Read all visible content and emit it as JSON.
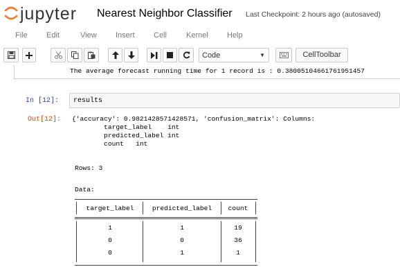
{
  "header": {
    "logo_text": "jupyter",
    "notebook_name": "Nearest Neighbor Classifier",
    "checkpoint": "Last Checkpoint: 2 hours ago (autosaved)"
  },
  "menubar": {
    "items": [
      "File",
      "Edit",
      "View",
      "Insert",
      "Cell",
      "Kernel",
      "Help"
    ]
  },
  "toolbar": {
    "cell_type": "Code",
    "celltoolbar_label": "CellToolbar",
    "icons": [
      "save-icon",
      "add-cell-icon",
      "cut-icon",
      "copy-icon",
      "paste-icon",
      "move-up-icon",
      "move-down-icon",
      "run-icon",
      "stop-icon",
      "restart-icon",
      "keyboard-icon"
    ]
  },
  "cells": {
    "prev_output": "The average forecast running time for 1 record is : 0.38005104661761951457",
    "in_prompt": "In  [12]:",
    "input_code": "results",
    "out_prompt": "Out[12]:",
    "output_lines": [
      "{'accuracy': 0.9821428571428571, 'confusion_matrix': Columns:",
      "        target_label    int",
      "        predicted_label int",
      "        count   int"
    ],
    "rows_line": "Rows: 3",
    "data_line": "Data:",
    "table": {
      "headers": [
        "target_label",
        "predicted_label",
        "count"
      ],
      "rows": [
        [
          "1",
          "1",
          "19"
        ],
        [
          "0",
          "0",
          "36"
        ],
        [
          "0",
          "1",
          "1"
        ]
      ]
    }
  },
  "colors": {
    "in_prompt": "#303f9f",
    "out_prompt": "#d84315",
    "logo_accent": "#f37626"
  }
}
